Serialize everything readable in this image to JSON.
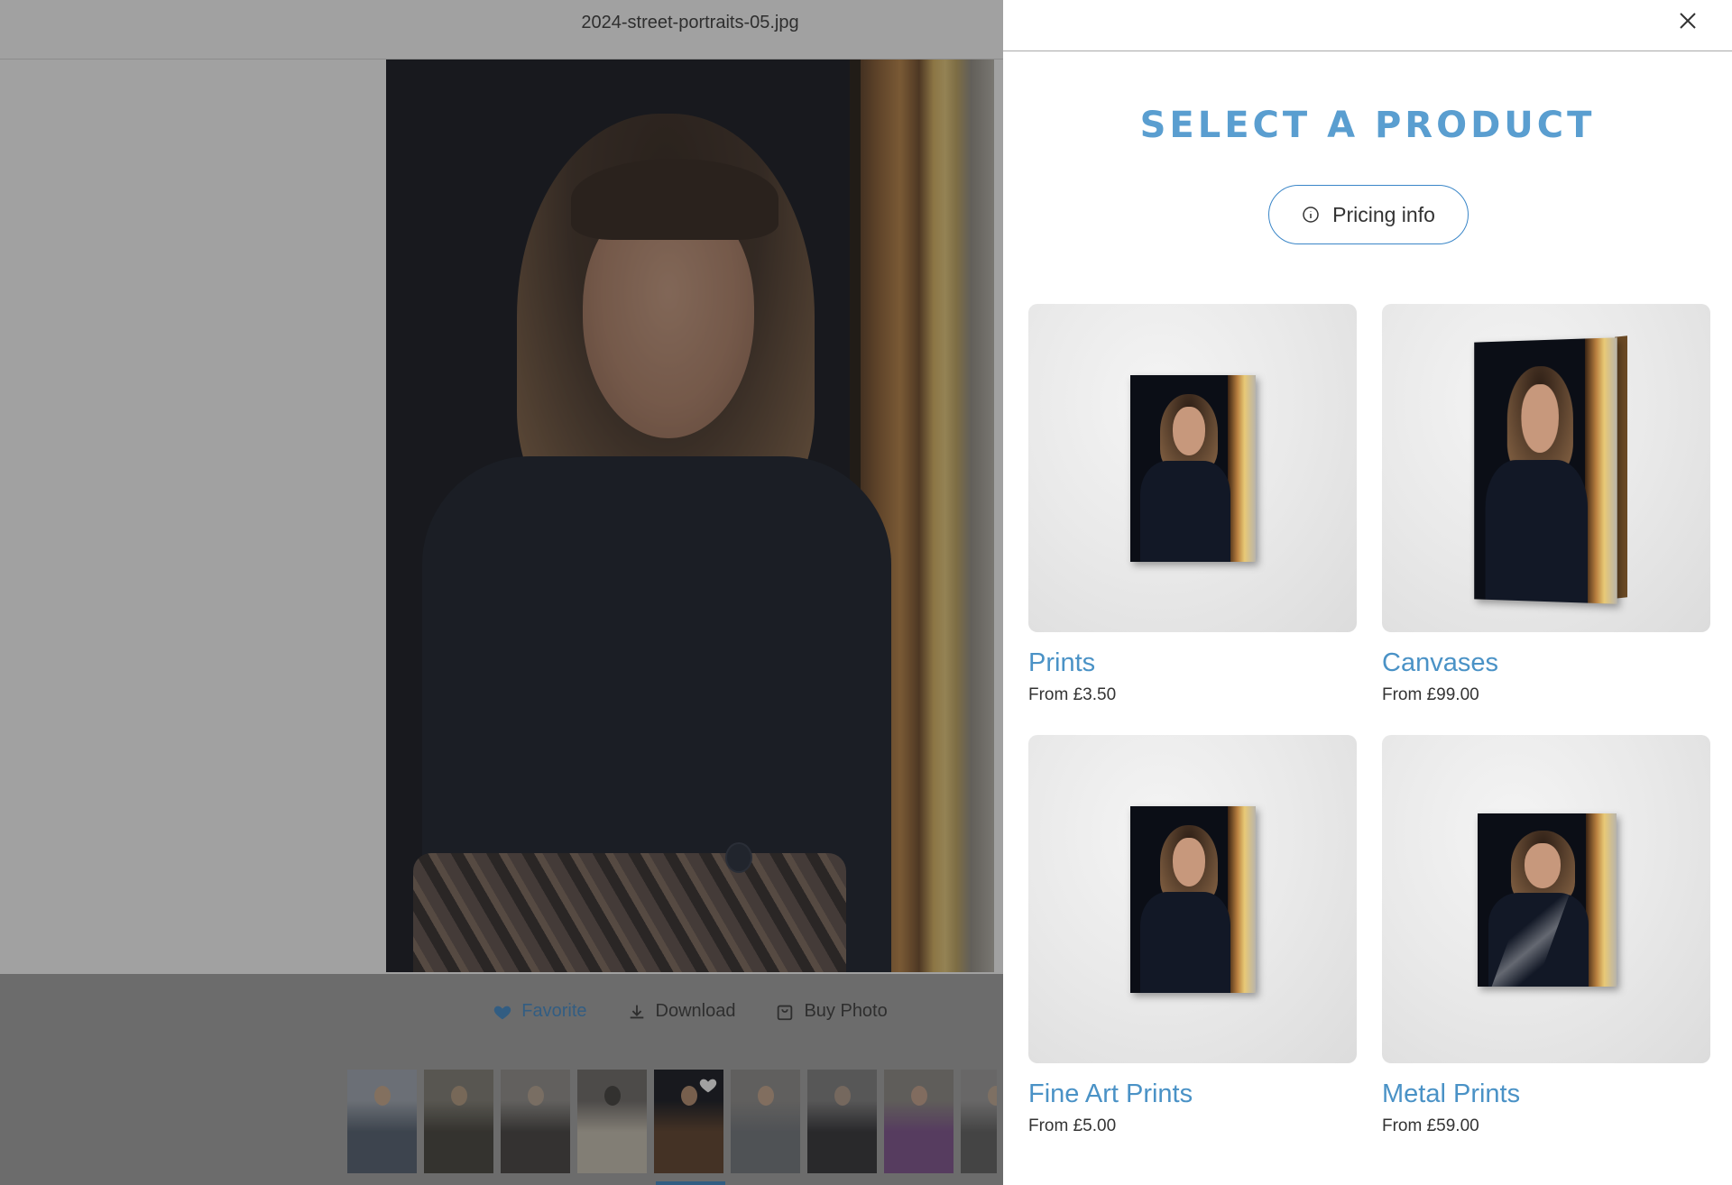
{
  "viewer": {
    "file_name": "2024-street-portraits-05.jpg",
    "actions": {
      "favorite_label": "Favorite",
      "download_label": "Download",
      "buy_label": "Buy Photo"
    },
    "thumbnails": [
      {
        "name": "couple-portrait",
        "colors": [
          "#9fa7b2",
          "#4d5a6b",
          "#c9a88a"
        ]
      },
      {
        "name": "two-men-portrait",
        "colors": [
          "#7d7a70",
          "#3e3b34",
          "#b49a7e"
        ]
      },
      {
        "name": "headscarf-portrait",
        "colors": [
          "#8f8c88",
          "#3d3a38",
          "#b8a590"
        ]
      },
      {
        "name": "man-cream-jacket",
        "colors": [
          "#6a6663",
          "#c8c0b0",
          "#3a3834"
        ]
      },
      {
        "name": "woman-dark-portrait",
        "colors": [
          "#0b0e16",
          "#5a3a22",
          "#b58a6a"
        ],
        "active": true,
        "favorited": true
      },
      {
        "name": "man-grey-sweater",
        "colors": [
          "#8c8a88",
          "#6e7278",
          "#c7a58a"
        ]
      },
      {
        "name": "man-leather-jacket",
        "colors": [
          "#7c7b7c",
          "#2a2a2e",
          "#b09a88"
        ]
      },
      {
        "name": "woman-purple-top",
        "colors": [
          "#8a8680",
          "#7a4b8a",
          "#c6a08a"
        ]
      },
      {
        "name": "partial-portrait",
        "colors": [
          "#9a9898",
          "#5a5a5a",
          "#c0a890"
        ]
      }
    ]
  },
  "panel": {
    "title": "SELECT A PRODUCT",
    "pricing_label": "Pricing info",
    "products": [
      {
        "name": "Prints",
        "price": "From £3.50",
        "style": "flat"
      },
      {
        "name": "Canvases",
        "price": "From £99.00",
        "style": "canvas"
      },
      {
        "name": "Fine Art Prints",
        "price": "From £5.00",
        "style": "flat"
      },
      {
        "name": "Metal Prints",
        "price": "From £59.00",
        "style": "metal"
      }
    ]
  },
  "colors": {
    "accent": "#3a86c8",
    "title_blue": "#5a9ed0",
    "product_name_blue": "#4a92c6"
  }
}
